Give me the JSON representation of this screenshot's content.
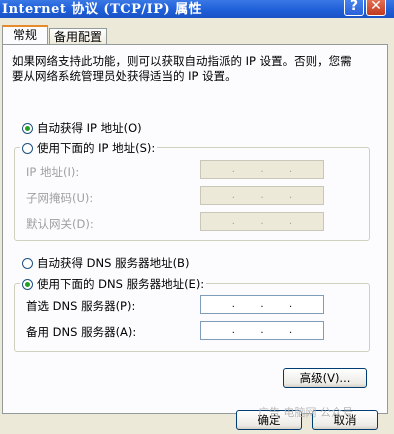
{
  "window": {
    "title": "Internet 协议 (TCP/IP) 属性",
    "help_label": "?",
    "close_label": "✕"
  },
  "tabs": [
    {
      "label": "常规",
      "active": true
    },
    {
      "label": "备用配置",
      "active": false
    }
  ],
  "description": "如果网络支持此功能，则可以获取自动指派的 IP 设置。否则，您需要从网络系统管理员处获得适当的 IP 设置。",
  "ip": {
    "auto_label": "自动获得 IP 地址(O)",
    "manual_label": "使用下面的 IP 地址(S):",
    "selected": "auto",
    "fields": [
      {
        "label": "IP 地址(I):",
        "value": ". . ."
      },
      {
        "label": "子网掩码(U):",
        "value": ". . ."
      },
      {
        "label": "默认网关(D):",
        "value": ". . ."
      }
    ]
  },
  "dns": {
    "auto_label": "自动获得 DNS 服务器地址(B)",
    "manual_label": "使用下面的 DNS 服务器地址(E):",
    "selected": "manual",
    "fields": [
      {
        "label": "首选 DNS 服务器(P):",
        "value": ". . ."
      },
      {
        "label": "备用 DNS 服务器(A):",
        "value": ". . ."
      }
    ]
  },
  "buttons": {
    "advanced": "高级(V)...",
    "ok": "确定",
    "cancel": "取消"
  },
  "watermark": "广告 电脑网 公众号"
}
